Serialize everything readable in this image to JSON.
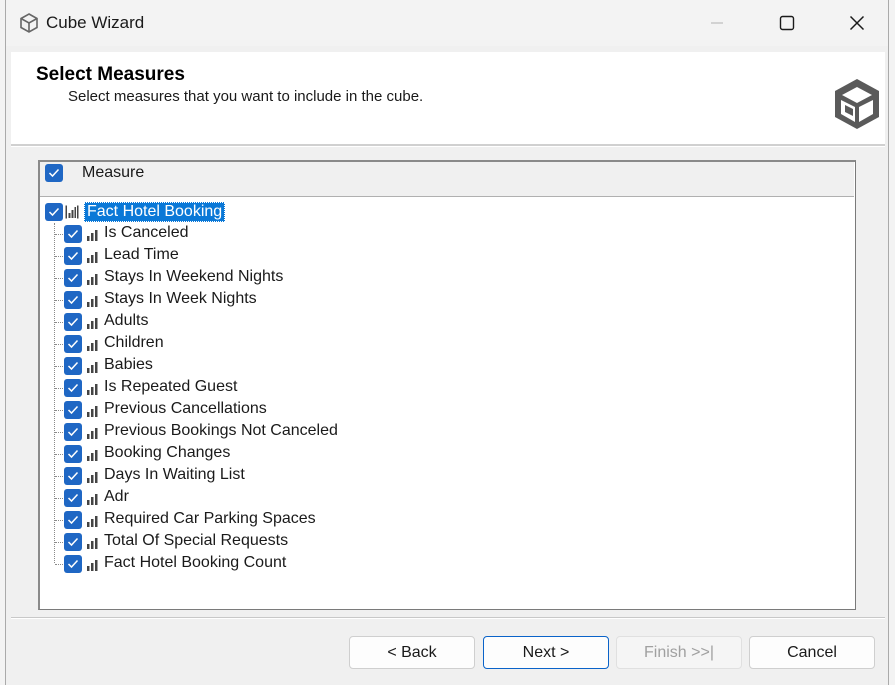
{
  "window": {
    "title": "Cube Wizard",
    "icon": "cube-icon",
    "controls": [
      "minimize-icon",
      "maximize-icon",
      "close-icon"
    ]
  },
  "header": {
    "title": "Select Measures",
    "subtitle": "Select measures that you want to include in the cube."
  },
  "list": {
    "column_header": "Measure",
    "header_checked": true,
    "root": {
      "label": "Fact Hotel Booking",
      "checked": true,
      "selected": true
    },
    "items": [
      {
        "label": "Is Canceled",
        "checked": true
      },
      {
        "label": "Lead Time",
        "checked": true
      },
      {
        "label": "Stays In Weekend Nights",
        "checked": true
      },
      {
        "label": "Stays In Week Nights",
        "checked": true
      },
      {
        "label": "Adults",
        "checked": true
      },
      {
        "label": "Children",
        "checked": true
      },
      {
        "label": "Babies",
        "checked": true
      },
      {
        "label": "Is Repeated Guest",
        "checked": true
      },
      {
        "label": "Previous Cancellations",
        "checked": true
      },
      {
        "label": "Previous Bookings Not Canceled",
        "checked": true
      },
      {
        "label": "Booking Changes",
        "checked": true
      },
      {
        "label": "Days In Waiting List",
        "checked": true
      },
      {
        "label": "Adr",
        "checked": true
      },
      {
        "label": "Required Car Parking Spaces",
        "checked": true
      },
      {
        "label": "Total Of Special Requests",
        "checked": true
      },
      {
        "label": "Fact Hotel Booking Count",
        "checked": true
      }
    ]
  },
  "buttons": {
    "back": "< Back",
    "next": "Next >",
    "finish": "Finish >>|",
    "cancel": "Cancel"
  },
  "colors": {
    "checkbox": "#1f67c4",
    "selection": "#0a78d7",
    "default_button_border": "#0a63c9"
  }
}
